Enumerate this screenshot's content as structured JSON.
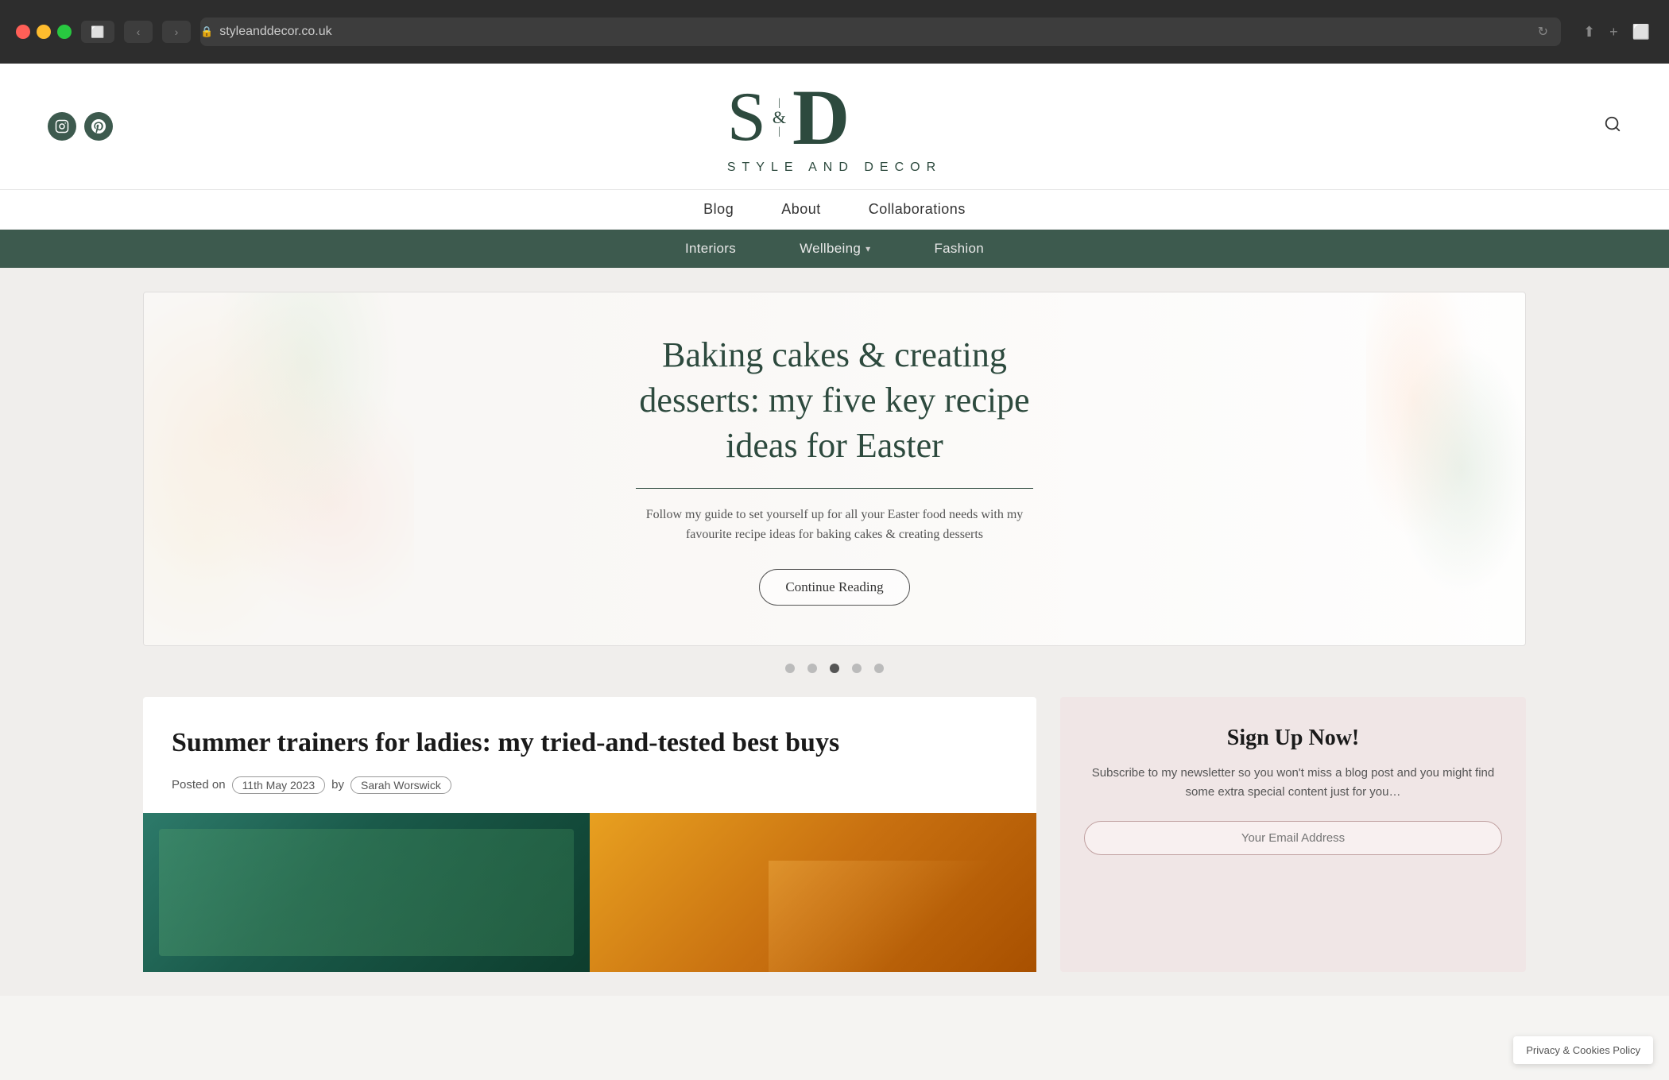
{
  "browser": {
    "url": "styleanddecor.co.uk",
    "back_btn": "‹",
    "forward_btn": "›"
  },
  "site": {
    "logo_s": "S",
    "logo_d": "D",
    "logo_ampersand": "&",
    "logo_subtitle": "STYLE AND DECOR",
    "social": {
      "instagram_label": "Instagram",
      "pinterest_label": "Pinterest"
    }
  },
  "main_nav": {
    "items": [
      {
        "label": "Blog",
        "href": "#"
      },
      {
        "label": "About",
        "href": "#"
      },
      {
        "label": "Collaborations",
        "href": "#"
      }
    ]
  },
  "category_nav": {
    "items": [
      {
        "label": "Interiors",
        "href": "#",
        "has_dropdown": false
      },
      {
        "label": "Wellbeing",
        "href": "#",
        "has_dropdown": true
      },
      {
        "label": "Fashion",
        "href": "#",
        "has_dropdown": false
      }
    ]
  },
  "hero": {
    "title": "Baking cakes & creating desserts: my five key recipe ideas for Easter",
    "description": "Follow my guide to set yourself up for all your Easter food needs with my favourite recipe ideas for baking cakes & creating desserts",
    "cta_label": "Continue Reading",
    "dots_count": 5,
    "active_dot": 2
  },
  "blog_post": {
    "title": "Summer trainers for ladies: my tried-and-tested best buys",
    "meta_prefix": "Posted on",
    "date": "11th May 2023",
    "author_prefix": "by",
    "author": "Sarah Worswick"
  },
  "newsletter": {
    "title": "Sign Up Now!",
    "description": "Subscribe to my newsletter so you won't miss a blog post and you might find some extra special content just for you…",
    "input_placeholder": "Your Email Address"
  },
  "privacy": {
    "label": "Privacy & Cookies Policy"
  }
}
